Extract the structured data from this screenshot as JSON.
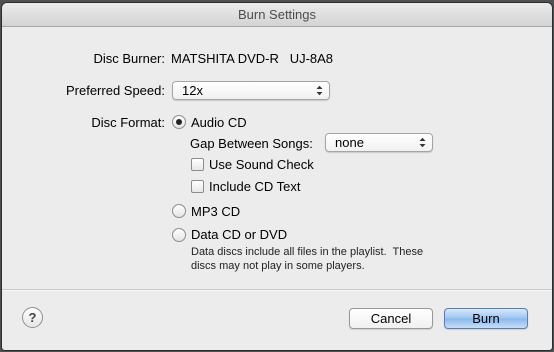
{
  "window": {
    "title": "Burn Settings"
  },
  "disc_burner": {
    "label": "Disc Burner:",
    "value": "MATSHITA DVD-R   UJ-8A8"
  },
  "preferred_speed": {
    "label": "Preferred Speed:",
    "value": "12x"
  },
  "disc_format": {
    "label": "Disc Format:",
    "selected": "Audio CD",
    "audio_cd": {
      "label": "Audio CD",
      "gap_label": "Gap Between Songs:",
      "gap_value": "none",
      "sound_check": {
        "label": "Use Sound Check",
        "checked": false
      },
      "cd_text": {
        "label": "Include CD Text",
        "checked": false
      }
    },
    "mp3_cd": {
      "label": "MP3 CD"
    },
    "data_cd": {
      "label": "Data CD or DVD",
      "note_line1": "Data discs include all files in the playlist.  These",
      "note_line2": "discs may not play in some players."
    }
  },
  "footer": {
    "help_label": "?",
    "cancel_label": "Cancel",
    "burn_label": "Burn"
  }
}
